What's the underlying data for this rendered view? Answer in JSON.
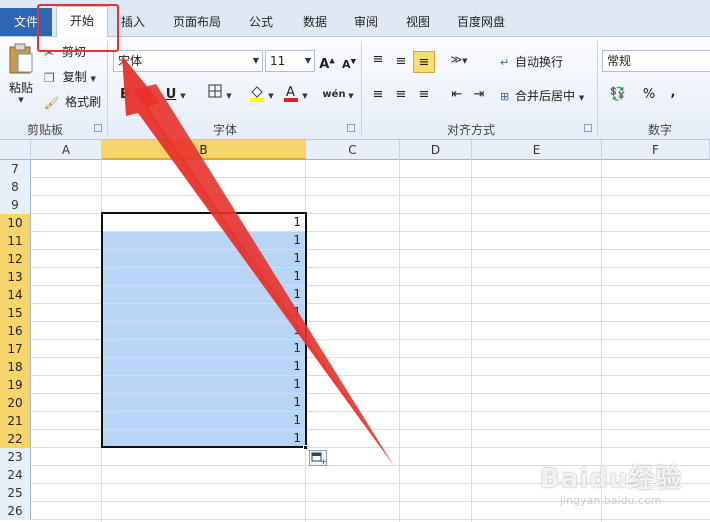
{
  "tabs": {
    "file": "文件",
    "home": "开始",
    "insert": "插入",
    "page_layout": "页面布局",
    "formulas": "公式",
    "data": "数据",
    "review": "审阅",
    "view": "视图",
    "baidu_netdisk": "百度网盘"
  },
  "clipboard": {
    "paste": "粘贴",
    "cut": "剪切",
    "copy": "复制",
    "format_painter": "格式刷",
    "group_label": "剪贴板"
  },
  "font": {
    "font_name": "宋体",
    "font_size": "11",
    "bold": "B",
    "underline": "U",
    "group_label": "字体",
    "text_color": "#e02020",
    "highlight_color": "#ffff00"
  },
  "alignment": {
    "wrap_text": "自动换行",
    "merge_center": "合并后居中",
    "group_label": "对齐方式"
  },
  "number": {
    "format": "常规",
    "percent": "%",
    "comma": ",",
    "group_label": "数字"
  },
  "columns": [
    "A",
    "B",
    "C",
    "D",
    "E",
    "F"
  ],
  "selected_column": "B",
  "rows": [
    {
      "num": "7",
      "b": ""
    },
    {
      "num": "8",
      "b": ""
    },
    {
      "num": "9",
      "b": ""
    },
    {
      "num": "10",
      "b": "1"
    },
    {
      "num": "11",
      "b": "1"
    },
    {
      "num": "12",
      "b": "1"
    },
    {
      "num": "13",
      "b": "1"
    },
    {
      "num": "14",
      "b": "1"
    },
    {
      "num": "15",
      "b": "1"
    },
    {
      "num": "16",
      "b": "1"
    },
    {
      "num": "17",
      "b": "1"
    },
    {
      "num": "18",
      "b": "1"
    },
    {
      "num": "19",
      "b": "1"
    },
    {
      "num": "20",
      "b": "1"
    },
    {
      "num": "21",
      "b": "1"
    },
    {
      "num": "22",
      "b": "1"
    },
    {
      "num": "23",
      "b": ""
    },
    {
      "num": "24",
      "b": ""
    },
    {
      "num": "25",
      "b": ""
    },
    {
      "num": "26",
      "b": ""
    }
  ],
  "selected_rows": [
    "10",
    "11",
    "12",
    "13",
    "14",
    "15",
    "16",
    "17",
    "18",
    "19",
    "20",
    "21",
    "22"
  ],
  "colors": {
    "annotation_red": "#e8322b",
    "selection_fill": "#b7d6f7",
    "header_highlight": "#f8d56a"
  },
  "watermark": {
    "logo": "Baidu经验",
    "url": "jingyan.baidu.com"
  }
}
